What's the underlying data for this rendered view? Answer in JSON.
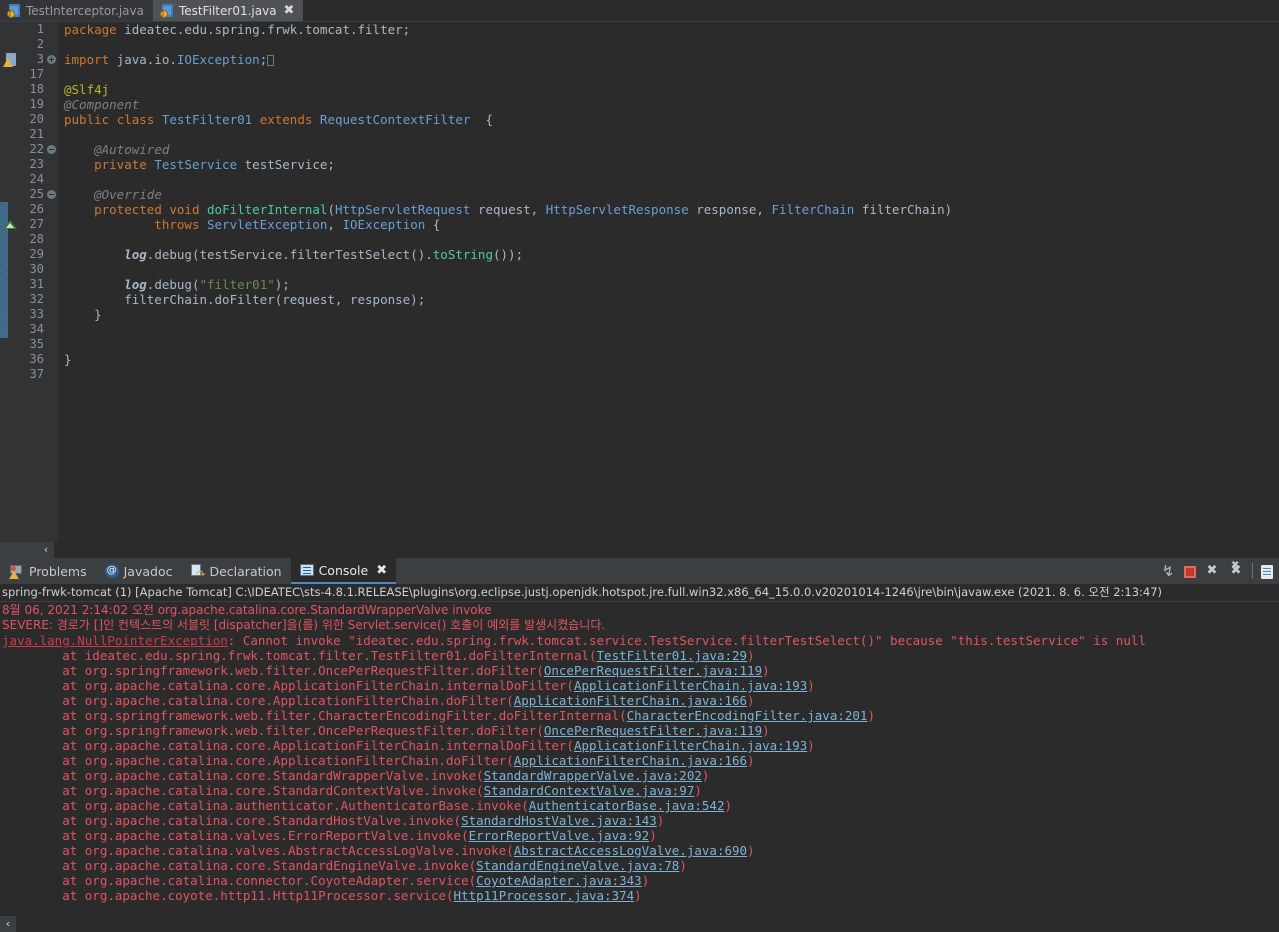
{
  "editor_tabs": [
    {
      "label": "TestInterceptor.java",
      "active": false,
      "icon": "java-file-icon"
    },
    {
      "label": "TestFilter01.java",
      "active": true,
      "icon": "java-file-icon",
      "close": "✖"
    }
  ],
  "editor": {
    "lines": [
      {
        "num": "1",
        "marker": "",
        "fold": "",
        "text": "package ideatec.edu.spring.frwk.tomcat.filter;"
      },
      {
        "num": "2",
        "marker": "",
        "fold": "",
        "text": ""
      },
      {
        "num": "3",
        "marker": "warning",
        "fold": "plus",
        "text": "import java.io.IOException;"
      },
      {
        "num": "17",
        "marker": "",
        "fold": "",
        "text": ""
      },
      {
        "num": "18",
        "marker": "",
        "fold": "",
        "text": "@Slf4j"
      },
      {
        "num": "19",
        "marker": "",
        "fold": "",
        "text": "@Component"
      },
      {
        "num": "20",
        "marker": "",
        "fold": "",
        "text": "public class TestFilter01 extends RequestContextFilter  {"
      },
      {
        "num": "21",
        "marker": "",
        "fold": "",
        "text": ""
      },
      {
        "num": "22",
        "marker": "",
        "fold": "minus",
        "text": "    @Autowired"
      },
      {
        "num": "23",
        "marker": "",
        "fold": "",
        "text": "    private TestService testService;"
      },
      {
        "num": "24",
        "marker": "",
        "fold": "",
        "text": ""
      },
      {
        "num": "25",
        "marker": "occurrence",
        "fold": "minus",
        "text": "    @Override"
      },
      {
        "num": "26",
        "marker": "override",
        "fold": "",
        "text": "    protected void doFilterInternal(HttpServletRequest request, HttpServletResponse response, FilterChain filterChain)"
      },
      {
        "num": "27",
        "marker": "occurrence",
        "fold": "",
        "text": "            throws ServletException, IOException {"
      },
      {
        "num": "28",
        "marker": "occurrence",
        "fold": "",
        "text": ""
      },
      {
        "num": "29",
        "marker": "occurrence",
        "fold": "",
        "text": "        log.debug(testService.filterTestSelect().toString());"
      },
      {
        "num": "30",
        "marker": "occurrence",
        "fold": "",
        "text": ""
      },
      {
        "num": "31",
        "marker": "occurrence",
        "fold": "",
        "text": "        log.debug(\"filter01\");"
      },
      {
        "num": "32",
        "marker": "occurrence",
        "fold": "",
        "text": "        filterChain.doFilter(request, response);"
      },
      {
        "num": "33",
        "marker": "occurrence",
        "fold": "",
        "text": "    }"
      },
      {
        "num": "34",
        "marker": "",
        "fold": "",
        "text": ""
      },
      {
        "num": "35",
        "marker": "",
        "fold": "",
        "text": ""
      },
      {
        "num": "36",
        "marker": "",
        "fold": "",
        "text": "}"
      },
      {
        "num": "37",
        "marker": "",
        "fold": "",
        "text": ""
      }
    ],
    "scroll_left_arrow": "‹"
  },
  "panel": {
    "tabs": [
      {
        "label": "Problems",
        "icon": "problems-icon",
        "active": false
      },
      {
        "label": "Javadoc",
        "icon": "javadoc-icon",
        "active": false
      },
      {
        "label": "Declaration",
        "icon": "declaration-icon",
        "active": false
      },
      {
        "label": "Console",
        "icon": "console-icon",
        "active": true,
        "close": "✖"
      }
    ],
    "tools": [
      {
        "name": "relaunch-icon"
      },
      {
        "name": "terminate-icon"
      },
      {
        "name": "remove-launch-icon"
      },
      {
        "name": "remove-all-terminated-icon"
      },
      {
        "name": "open-console-icon"
      }
    ]
  },
  "console": {
    "header": "spring-frwk-tomcat (1) [Apache Tomcat] C:\\IDEATEC\\sts-4.8.1.RELEASE\\plugins\\org.eclipse.justj.openjdk.hotspot.jre.full.win32.x86_64_15.0.0.v20201014-1246\\jre\\bin\\javaw.exe  (2021. 8. 6. 오전 2:13:47)",
    "lines": [
      {
        "type": "plain",
        "text": "8월 06, 2021 2:14:02 오전 org.apache.catalina.core.StandardWrapperValve invoke",
        "korean": true
      },
      {
        "type": "plain",
        "text": "SEVERE: 경로가 []인 컨텍스트의 서블릿 [dispatcher]을(를) 위한 Servlet.service() 호출이 예외를 발생시켰습니다.",
        "korean": true
      },
      {
        "type": "exception",
        "link": "java.lang.NullPointerException",
        "text": ": Cannot invoke \"ideatec.edu.spring.frwk.tomcat.service.TestService.filterTestSelect()\" because \"this.testService\" is null"
      },
      {
        "type": "at",
        "prefix": "        at ideatec.edu.spring.frwk.tomcat.filter.TestFilter01.doFilterInternal(",
        "link": "TestFilter01.java:29",
        "suffix": ")"
      },
      {
        "type": "at",
        "prefix": "        at org.springframework.web.filter.OncePerRequestFilter.doFilter(",
        "link": "OncePerRequestFilter.java:119",
        "suffix": ")"
      },
      {
        "type": "at",
        "prefix": "        at org.apache.catalina.core.ApplicationFilterChain.internalDoFilter(",
        "link": "ApplicationFilterChain.java:193",
        "suffix": ")"
      },
      {
        "type": "at",
        "prefix": "        at org.apache.catalina.core.ApplicationFilterChain.doFilter(",
        "link": "ApplicationFilterChain.java:166",
        "suffix": ")"
      },
      {
        "type": "at",
        "prefix": "        at org.springframework.web.filter.CharacterEncodingFilter.doFilterInternal(",
        "link": "CharacterEncodingFilter.java:201",
        "suffix": ")"
      },
      {
        "type": "at",
        "prefix": "        at org.springframework.web.filter.OncePerRequestFilter.doFilter(",
        "link": "OncePerRequestFilter.java:119",
        "suffix": ")"
      },
      {
        "type": "at",
        "prefix": "        at org.apache.catalina.core.ApplicationFilterChain.internalDoFilter(",
        "link": "ApplicationFilterChain.java:193",
        "suffix": ")"
      },
      {
        "type": "at",
        "prefix": "        at org.apache.catalina.core.ApplicationFilterChain.doFilter(",
        "link": "ApplicationFilterChain.java:166",
        "suffix": ")"
      },
      {
        "type": "at",
        "prefix": "        at org.apache.catalina.core.StandardWrapperValve.invoke(",
        "link": "StandardWrapperValve.java:202",
        "suffix": ")"
      },
      {
        "type": "at",
        "prefix": "        at org.apache.catalina.core.StandardContextValve.invoke(",
        "link": "StandardContextValve.java:97",
        "suffix": ")"
      },
      {
        "type": "at",
        "prefix": "        at org.apache.catalina.authenticator.AuthenticatorBase.invoke(",
        "link": "AuthenticatorBase.java:542",
        "suffix": ")"
      },
      {
        "type": "at",
        "prefix": "        at org.apache.catalina.core.StandardHostValve.invoke(",
        "link": "StandardHostValve.java:143",
        "suffix": ")"
      },
      {
        "type": "at",
        "prefix": "        at org.apache.catalina.valves.ErrorReportValve.invoke(",
        "link": "ErrorReportValve.java:92",
        "suffix": ")"
      },
      {
        "type": "at",
        "prefix": "        at org.apache.catalina.valves.AbstractAccessLogValve.invoke(",
        "link": "AbstractAccessLogValve.java:690",
        "suffix": ")"
      },
      {
        "type": "at",
        "prefix": "        at org.apache.catalina.core.StandardEngineValve.invoke(",
        "link": "StandardEngineValve.java:78",
        "suffix": ")"
      },
      {
        "type": "at",
        "prefix": "        at org.apache.catalina.connector.CoyoteAdapter.service(",
        "link": "CoyoteAdapter.java:343",
        "suffix": ")"
      },
      {
        "type": "at",
        "prefix": "        at org.apache.coyote.http11.Http11Processor.service(",
        "link": "Http11Processor.java:374",
        "suffix": ")"
      }
    ],
    "scroll_left_arrow": "‹"
  },
  "colors": {
    "editor_bg": "#2b2b2b",
    "gutter_bg": "#313335",
    "panel_bg": "#3c3f41",
    "accent": "#4a88c7",
    "error": "#e05561",
    "link": "#7fb3d5"
  }
}
